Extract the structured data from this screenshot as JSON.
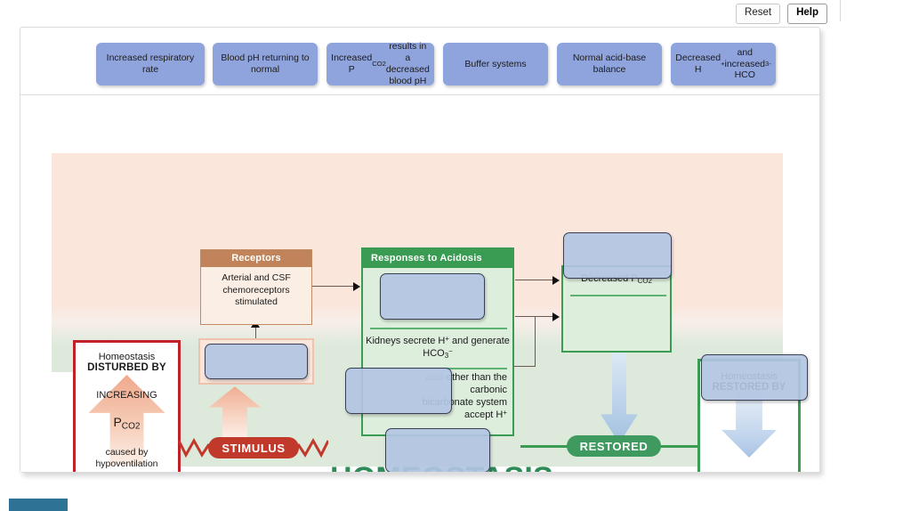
{
  "toolbar": {
    "reset_label": "Reset",
    "help_label": "Help"
  },
  "tray": {
    "tiles": [
      {
        "id": "tile-1",
        "label": "Increased respiratory rate"
      },
      {
        "id": "tile-2",
        "label": "Blood pH returning to normal"
      },
      {
        "id": "tile-3",
        "label": "Increased P<sub>CO2</sub> results in a decreased blood pH"
      },
      {
        "id": "tile-4",
        "label": "Buffer systems"
      },
      {
        "id": "tile-5",
        "label": "Normal acid-base balance"
      },
      {
        "id": "tile-6",
        "label": "Decreased H<sup>+</sup> and increased HCO<sub>3</sub><sup>-</sup>"
      }
    ]
  },
  "diagram": {
    "center_title": "HOMEOSTASIS",
    "disturbed_box": {
      "line1": "Homeostasis",
      "line2": "DISTURBED BY",
      "line3": "INCREASING",
      "line4": "P<sub>CO2</sub>",
      "line5": "caused by hypoventilation"
    },
    "receptors_box": {
      "header": "Receptors",
      "body": "Arterial and CSF chemoreceptors stimulated"
    },
    "responses_box": {
      "header": "Responses to Acidosis",
      "row2": "Kidneys secrete H<sup>+</sup> and generate HCO<sub>3</sub><sup>&minus;</sup>",
      "row3_faded": "acid-",
      "row3": "other than the carbonic bicarbonate system accept H<sup>+</sup>"
    },
    "decreased_box": {
      "label": "Decreased P<sub>CO2</sub>"
    },
    "restored_box": {
      "line1": "Homeostasis",
      "line2": "RESTORED BY"
    },
    "stimulus_pill": "STIMULUS",
    "restored_pill": "RESTORED",
    "drop_zones": [
      {
        "id": "dz-left",
        "value": ""
      },
      {
        "id": "dz-responses-1",
        "value": ""
      },
      {
        "id": "dz-responses-3",
        "value": ""
      },
      {
        "id": "dz-decreased",
        "value": ""
      },
      {
        "id": "dz-restored",
        "value": ""
      },
      {
        "id": "dz-bottom",
        "value": ""
      }
    ]
  },
  "colors": {
    "tile": "#8fa3dd",
    "dropzone": "#b2c4e2",
    "red_box": "#c02028",
    "green": "#3a9b52",
    "brown": "#c0835a",
    "stimulus": "#c0392b",
    "homeostasis_text": "#2e8b57"
  }
}
